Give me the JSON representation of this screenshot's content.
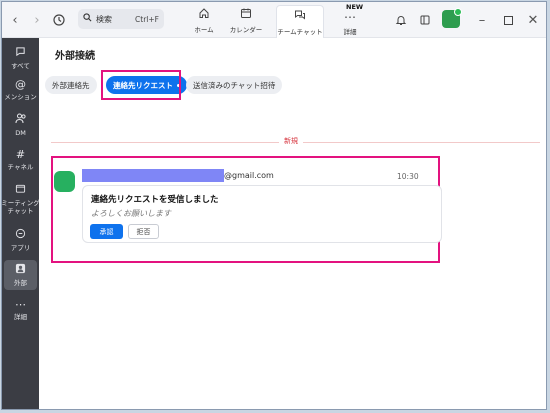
{
  "titlebar": {
    "search_placeholder": "検索",
    "search_shortcut": "Ctrl+F",
    "tabs": [
      {
        "label": "ホーム",
        "icon": "home-icon"
      },
      {
        "label": "カレンダー",
        "icon": "calendar-icon"
      },
      {
        "label": "チームチャット",
        "icon": "chat-icon",
        "active": true
      },
      {
        "label": "詳細",
        "icon": "more-icon",
        "badge": "NEW"
      }
    ]
  },
  "sidebar": {
    "items": [
      {
        "label": "すべて",
        "icon": "chat-bubble-icon"
      },
      {
        "label": "メンション",
        "icon": "at-icon"
      },
      {
        "label": "DM",
        "icon": "people-icon"
      },
      {
        "label": "チャネル",
        "icon": "hash-icon"
      },
      {
        "label": "ミーティング\nチャット",
        "icon": "meeting-icon"
      },
      {
        "label": "アプリ",
        "icon": "app-icon"
      },
      {
        "label": "外部",
        "icon": "external-icon",
        "active": true
      },
      {
        "label": "詳細",
        "icon": "more-icon"
      }
    ]
  },
  "main": {
    "title": "外部接続",
    "tabs": [
      "外部連絡先",
      "連絡先リクエスト",
      "送信済みのチャット招待"
    ],
    "active_tab": 1,
    "divider_label": "新規",
    "message": {
      "email_domain": "@gmail.com",
      "time": "10:30",
      "card_title": "連絡先リクエストを受信しました",
      "card_subtitle": "よろしくお願いします",
      "approve_label": "承認",
      "reject_label": "拒否"
    }
  },
  "colors": {
    "accent": "#0e72ed",
    "highlight": "#e3127f",
    "sidebar_bg": "#3b3d44"
  }
}
